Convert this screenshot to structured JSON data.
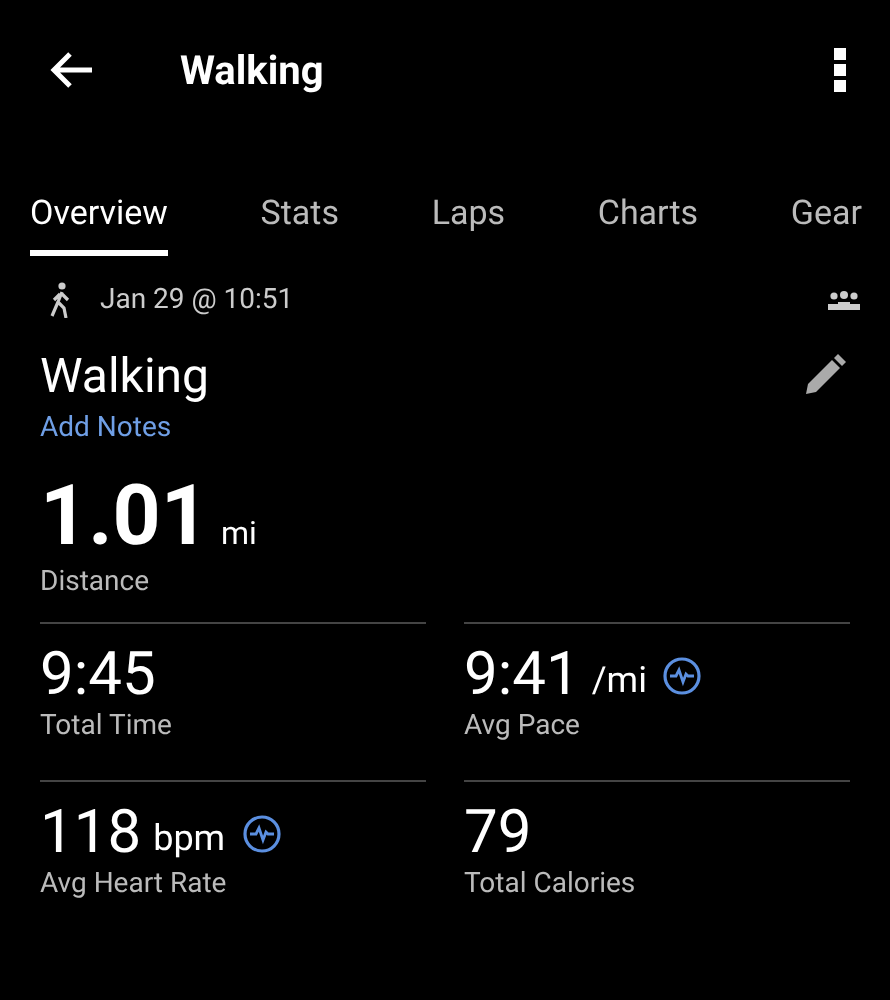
{
  "header": {
    "title": "Walking"
  },
  "tabs": [
    {
      "label": "Overview",
      "selected": true
    },
    {
      "label": "Stats",
      "selected": false
    },
    {
      "label": "Laps",
      "selected": false
    },
    {
      "label": "Charts",
      "selected": false
    },
    {
      "label": "Gear",
      "selected": false
    }
  ],
  "activity": {
    "date": "Jan 29 @ 10:51",
    "name": "Walking",
    "notes_link": "Add Notes"
  },
  "distance": {
    "value": "1.01",
    "unit": "mi",
    "label": "Distance"
  },
  "stats": [
    {
      "value": "9:45",
      "label": "Total Time",
      "insight": false
    },
    {
      "value": "9:41",
      "unit": "/mi",
      "label": "Avg Pace",
      "insight": true
    },
    {
      "value": "118",
      "unit": "bpm",
      "label": "Avg Heart Rate",
      "insight": true
    },
    {
      "value": "79",
      "label": "Total Calories",
      "insight": false
    }
  ]
}
